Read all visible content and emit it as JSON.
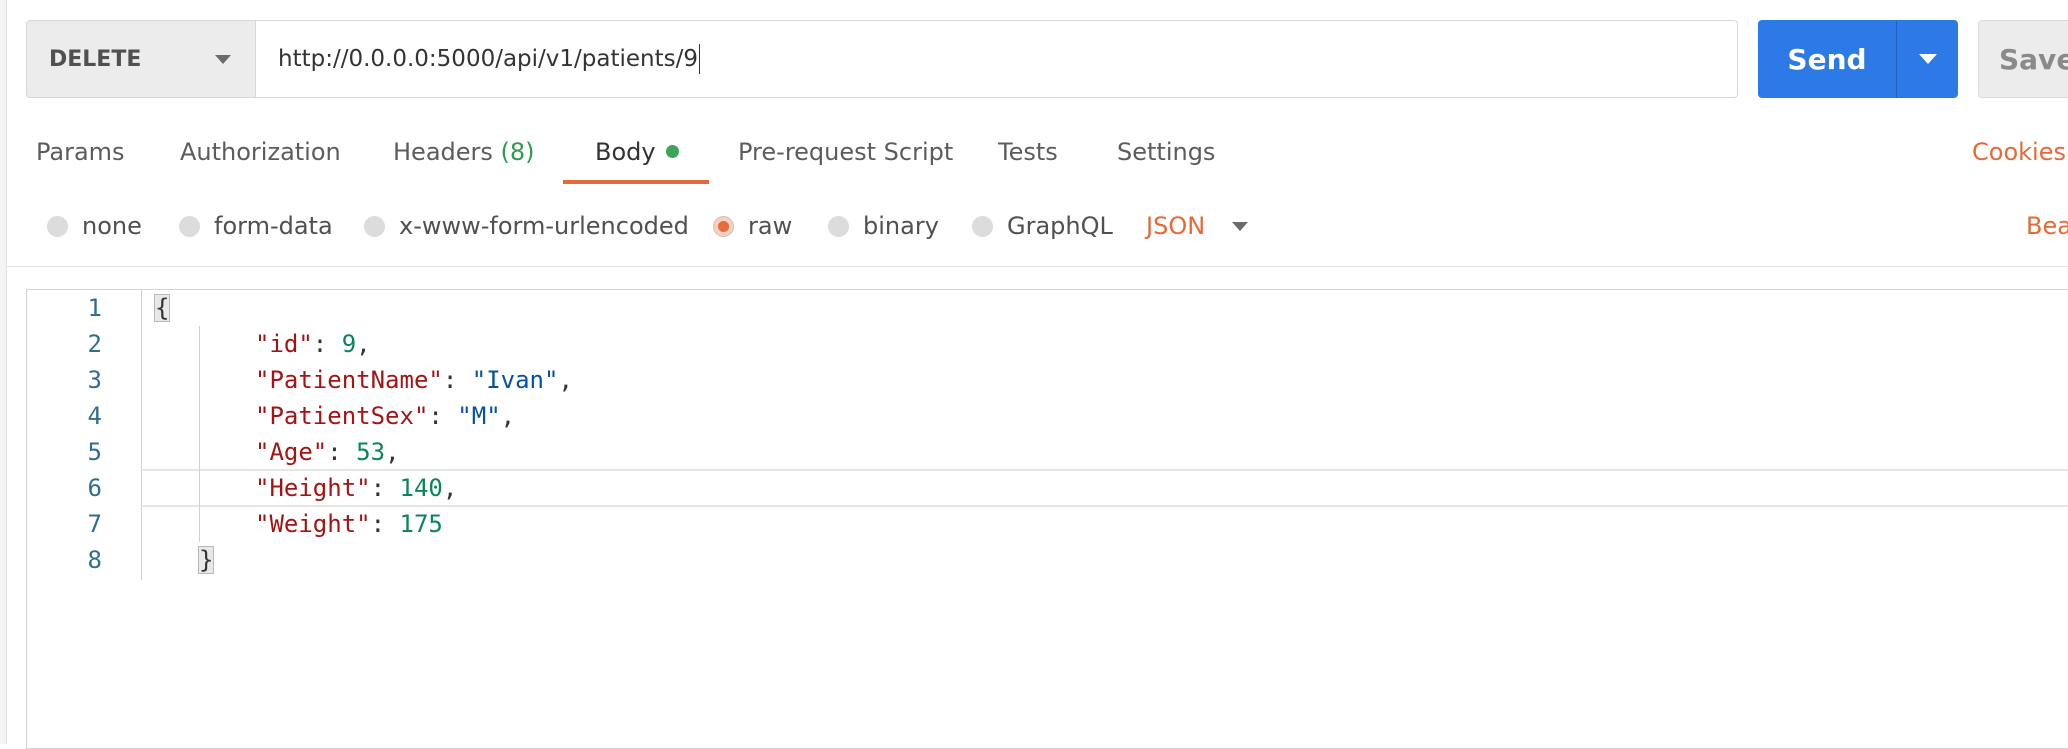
{
  "request": {
    "method": "DELETE",
    "url": "http://0.0.0.0:5000/api/v1/patients/9",
    "send_label": "Send",
    "save_label": "Save"
  },
  "tabs": [
    {
      "label": "Params"
    },
    {
      "label": "Authorization"
    },
    {
      "label": "Headers",
      "count": "(8)"
    },
    {
      "label": "Body",
      "active": true
    },
    {
      "label": "Pre-request Script"
    },
    {
      "label": "Tests"
    },
    {
      "label": "Settings"
    }
  ],
  "cookies_label": "Cookies",
  "body_types": [
    {
      "label": "none"
    },
    {
      "label": "form-data"
    },
    {
      "label": "x-www-form-urlencoded"
    },
    {
      "label": "raw",
      "checked": true
    },
    {
      "label": "binary"
    },
    {
      "label": "GraphQL"
    }
  ],
  "raw_format": "JSON",
  "beautify_label": "Bea",
  "editor": {
    "lines": [
      {
        "no": "1",
        "open": "{"
      },
      {
        "no": "2",
        "key": "\"id\"",
        "sep": ": ",
        "num": "9",
        "end": ","
      },
      {
        "no": "3",
        "key": "\"PatientName\"",
        "sep": ": ",
        "str": "\"Ivan\"",
        "end": ","
      },
      {
        "no": "4",
        "key": "\"PatientSex\"",
        "sep": ": ",
        "str": "\"M\"",
        "end": ","
      },
      {
        "no": "5",
        "key": "\"Age\"",
        "sep": ": ",
        "num": "53",
        "end": ","
      },
      {
        "no": "6",
        "key": "\"Height\"",
        "sep": ": ",
        "num": "140",
        "end": ","
      },
      {
        "no": "7",
        "key": "\"Weight\"",
        "sep": ": ",
        "num": "175",
        "end": ""
      },
      {
        "no": "8",
        "close": "}"
      }
    ]
  },
  "colors": {
    "accent_orange": "#e56a37",
    "send_blue": "#2b7ae6",
    "body_dot_green": "#3fa457",
    "json_key": "#a31515",
    "json_number": "#098658",
    "json_string": "#0451a5"
  }
}
